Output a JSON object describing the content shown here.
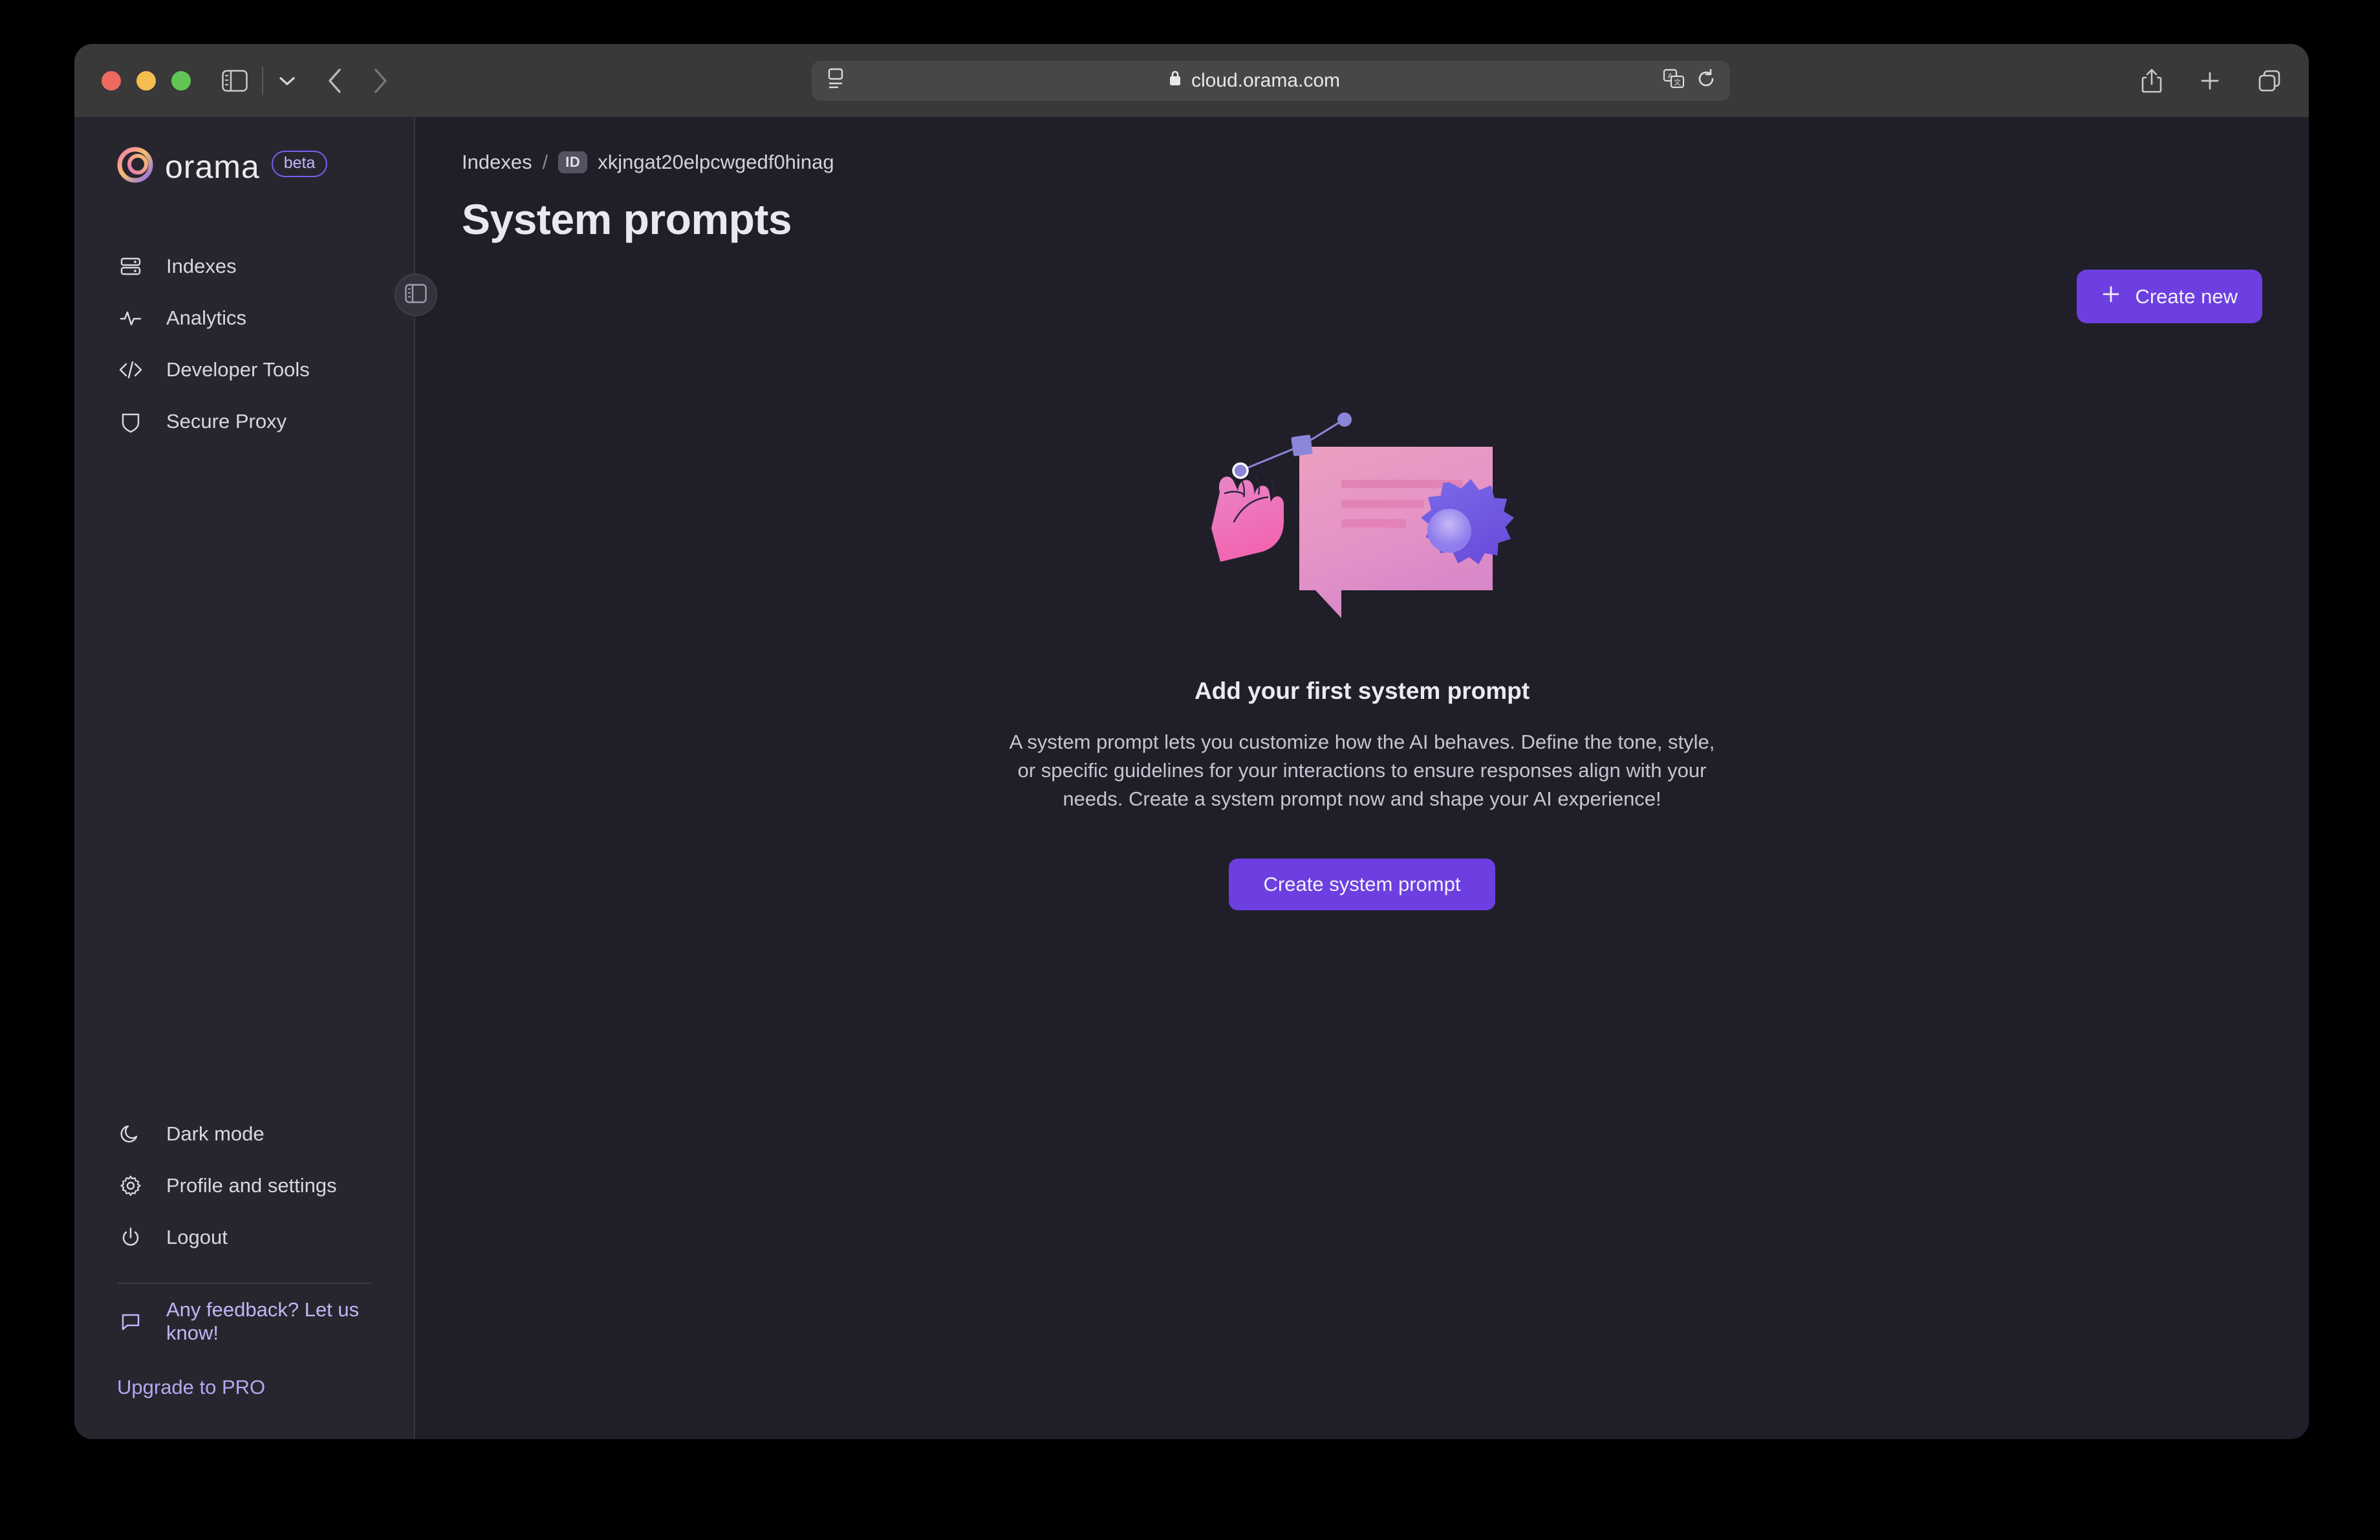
{
  "browser": {
    "url": "cloud.orama.com",
    "lock_icon": "lock-icon",
    "sidebar_toggle_icon": "sidebar-toggle-icon",
    "chevron_icon": "chevron-down-icon",
    "back_icon": "back-arrow-icon",
    "forward_icon": "forward-arrow-icon",
    "reader_icon": "reader-view-icon",
    "translate_icon": "translate-icon",
    "reload_icon": "reload-icon",
    "share_icon": "share-icon",
    "newtab_icon": "plus-icon",
    "tabs_icon": "tab-overview-icon"
  },
  "sidebar": {
    "brand": "orama",
    "badge": "beta",
    "items": [
      {
        "label": "Indexes",
        "icon": "server-stack-icon"
      },
      {
        "label": "Analytics",
        "icon": "activity-icon"
      },
      {
        "label": "Developer Tools",
        "icon": "code-brackets-icon"
      },
      {
        "label": "Secure Proxy",
        "icon": "shield-icon"
      }
    ],
    "bottom_items": [
      {
        "label": "Dark mode",
        "icon": "moon-icon"
      },
      {
        "label": "Profile and settings",
        "icon": "gear-icon"
      },
      {
        "label": "Logout",
        "icon": "power-icon"
      }
    ],
    "feedback": {
      "label": "Any feedback? Let us know!",
      "icon": "chat-bubble-icon"
    },
    "upgrade": "Upgrade to PRO",
    "collapse_icon": "sidebar-collapse-icon"
  },
  "breadcrumb": {
    "root": "Indexes",
    "separator": "/",
    "id_badge": "ID",
    "index_id": "xkjngat20elpcwgedf0hinag"
  },
  "page": {
    "title": "System prompts",
    "create_new": "Create new",
    "create_new_icon": "plus-icon"
  },
  "empty_state": {
    "illustration": "speech-bubble-gear-hand-illustration",
    "title": "Add your first system prompt",
    "body": "A system prompt lets you customize how the AI behaves. Define the tone, style, or specific guidelines for your interactions to ensure responses align with your needs. Create a system prompt now and shape your AI experience!",
    "cta": "Create system prompt"
  },
  "colors": {
    "accent": "#6d3fe0",
    "sidebar_bg": "#27262f",
    "main_bg": "#201f29",
    "toolbar_bg": "#393939",
    "link_purple": "#b6a6f0"
  }
}
